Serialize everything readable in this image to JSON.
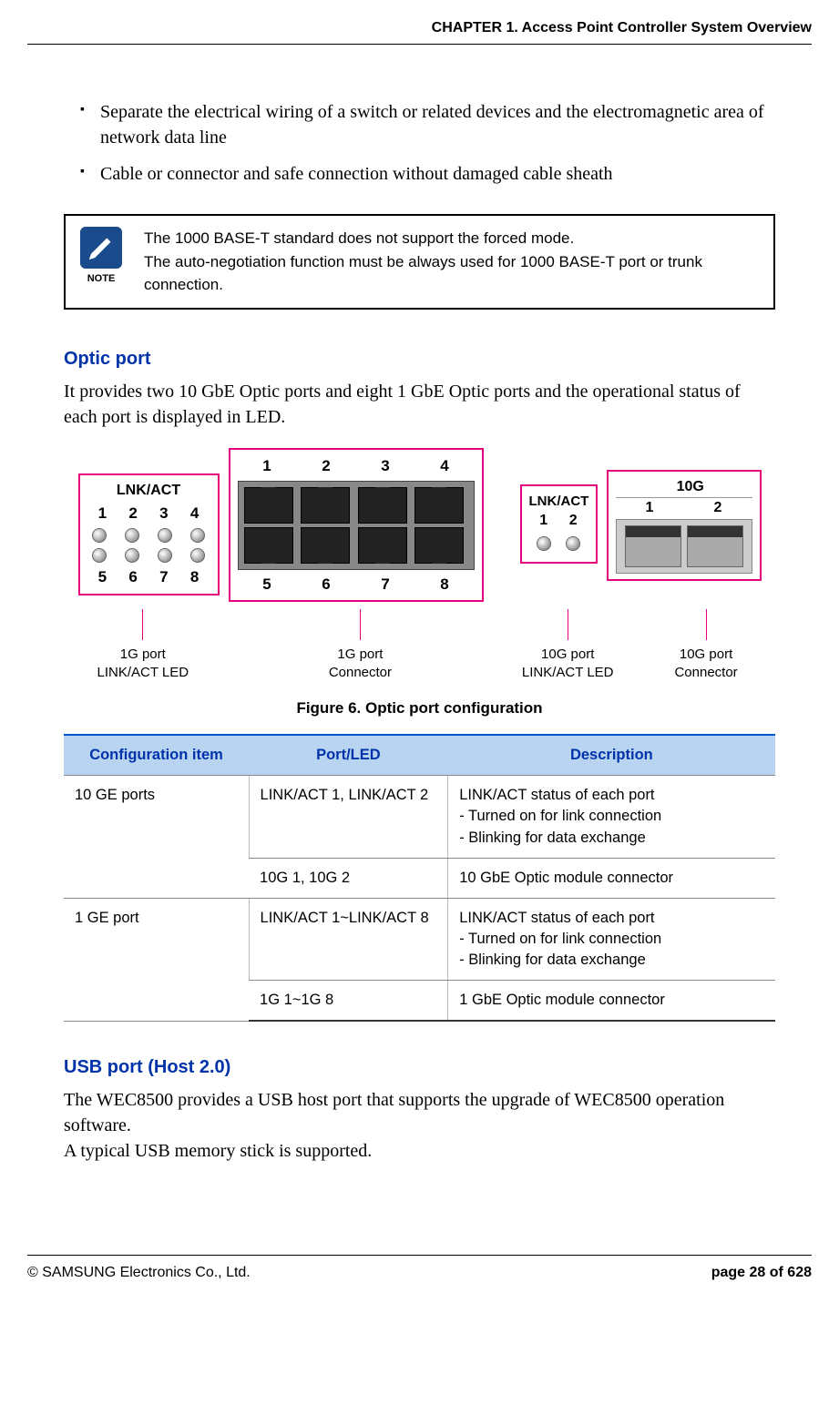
{
  "header": {
    "chapter": "CHAPTER 1. Access Point Controller System Overview"
  },
  "bullets": [
    "Separate the electrical wiring of a switch or related devices and the electromagnetic area of network data line",
    "Cable or connector and safe connection without damaged cable sheath"
  ],
  "note": {
    "label": "NOTE",
    "line1": "The 1000 BASE-T standard does not support the forced mode.",
    "line2": "The auto-negotiation function must be always used for 1000 BASE-T port or trunk connection."
  },
  "sections": {
    "optic": {
      "title": "Optic port",
      "body": "It provides two 10 GbE Optic ports and eight 1 GbE Optic ports and the operational status of each port is displayed in LED."
    },
    "usb": {
      "title": "USB port (Host 2.0)",
      "body1": "The WEC8500 provides a USB host port that supports the upgrade of WEC8500 operation software.",
      "body2": "A typical USB memory stick is supported."
    }
  },
  "figure": {
    "led8_title": "LNK/ACT",
    "led8_top": [
      "1",
      "2",
      "3",
      "4"
    ],
    "led8_bot": [
      "5",
      "6",
      "7",
      "8"
    ],
    "conn8_top": [
      "1",
      "2",
      "3",
      "4"
    ],
    "conn8_bot": [
      "5",
      "6",
      "7",
      "8"
    ],
    "led2_title": "LNK/ACT",
    "led2_nums": [
      "1",
      "2"
    ],
    "conn10_label": "10G",
    "conn10_nums": [
      "1",
      "2"
    ],
    "callouts": {
      "c1_l1": "1G port",
      "c1_l2": "LINK/ACT LED",
      "c2_l1": "1G port",
      "c2_l2": "Connector",
      "c3_l1": "10G port",
      "c3_l2": "LINK/ACT LED",
      "c4_l1": "10G port",
      "c4_l2": "Connector"
    },
    "caption": "Figure 6. Optic port configuration"
  },
  "table": {
    "headers": [
      "Configuration item",
      "Port/LED",
      "Description"
    ],
    "rows": [
      {
        "config": "10 GE ports",
        "port": "LINK/ACT 1, LINK/ACT 2",
        "desc_l1": "LINK/ACT status of each port",
        "desc_l2": "- Turned on for link connection",
        "desc_l3": "- Blinking for data exchange"
      },
      {
        "config": "",
        "port": "10G 1, 10G 2",
        "desc_l1": "10 GbE Optic module connector",
        "desc_l2": "",
        "desc_l3": ""
      },
      {
        "config": "1 GE port",
        "port": "LINK/ACT 1~LINK/ACT 8",
        "desc_l1": "LINK/ACT status of each port",
        "desc_l2": "- Turned on for link connection",
        "desc_l3": "- Blinking for data exchange"
      },
      {
        "config": "",
        "port": "1G 1~1G 8",
        "desc_l1": "1 GbE Optic module connector",
        "desc_l2": "",
        "desc_l3": ""
      }
    ]
  },
  "footer": {
    "copyright": "© SAMSUNG Electronics Co., Ltd.",
    "page": "page 28 of 628"
  }
}
